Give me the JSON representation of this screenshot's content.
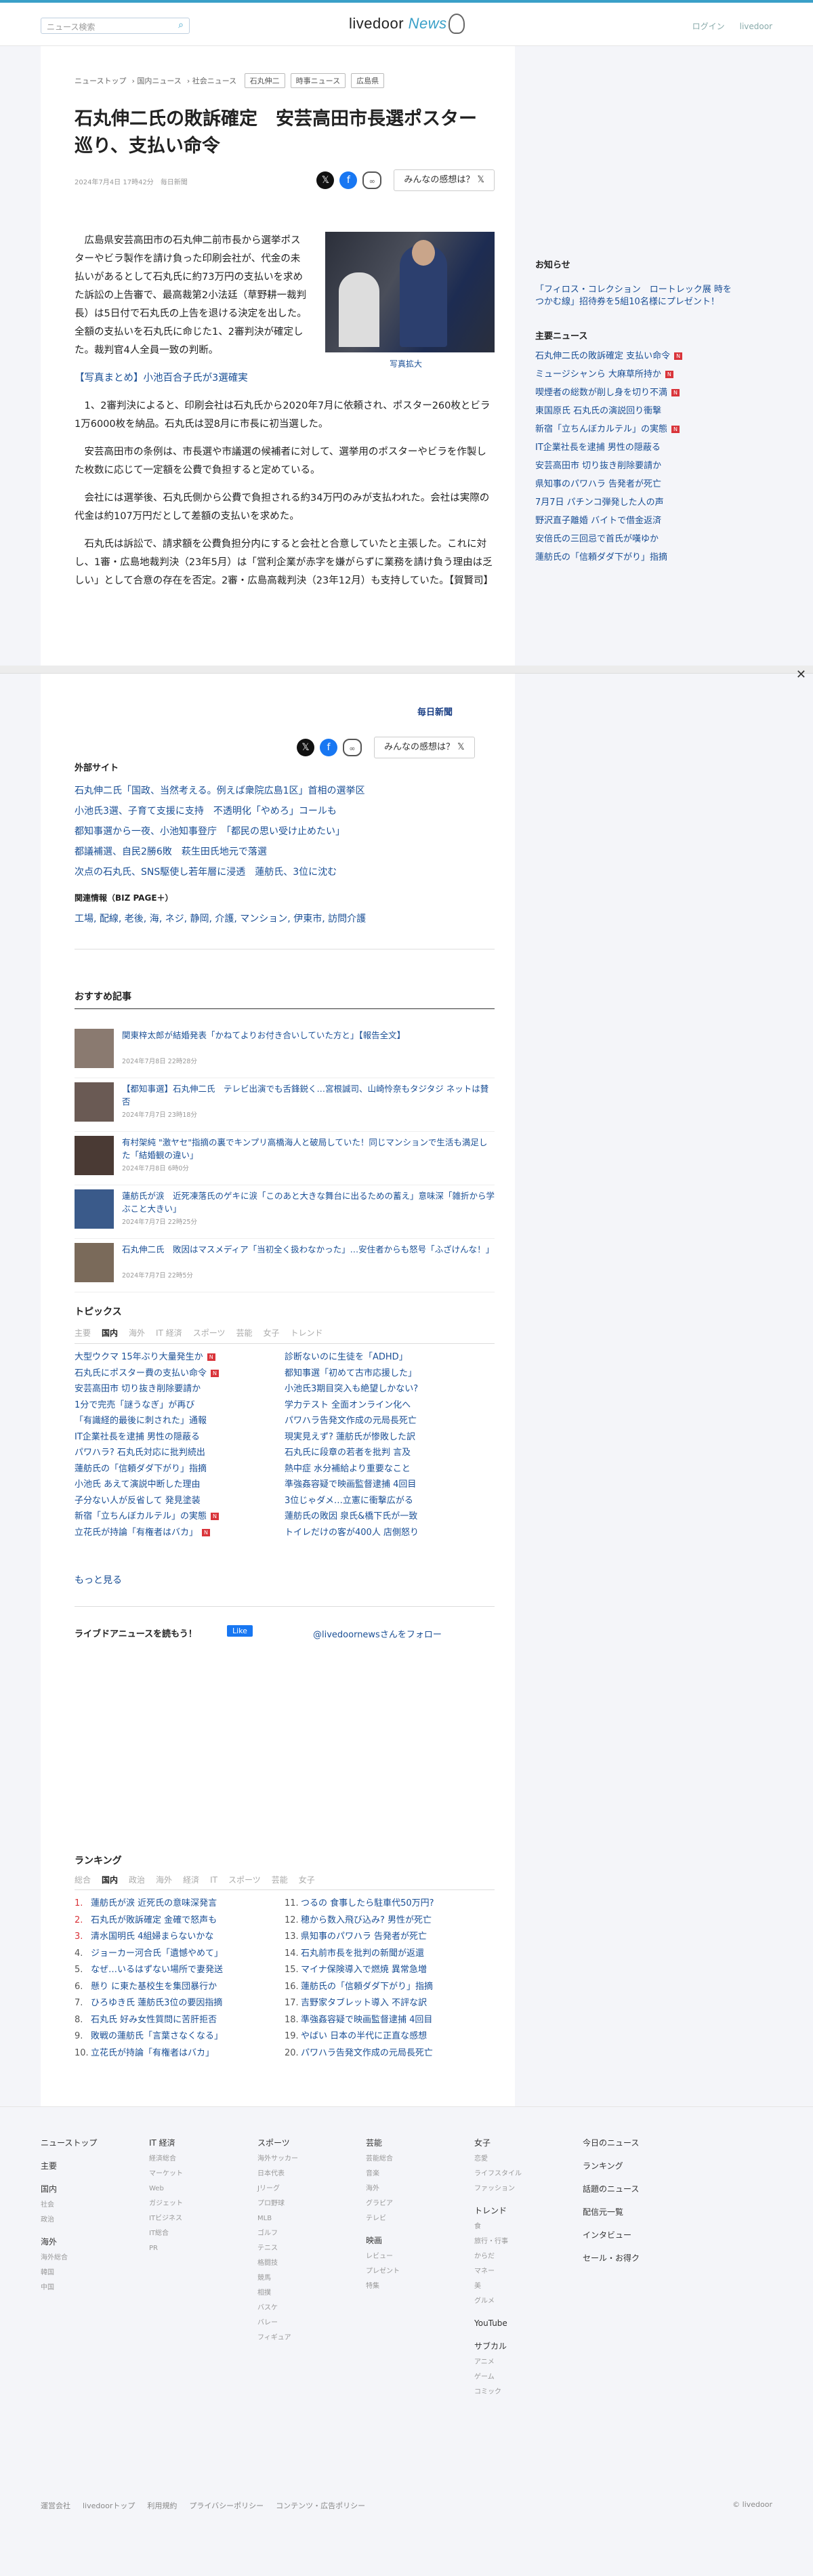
{
  "header": {
    "search_placeholder": "ニュース検索",
    "logo_main": "livedoor ",
    "logo_accent": "News",
    "login": "ログイン",
    "livedoor": "livedoor"
  },
  "breadcrumb": [
    "ニューストップ",
    "国内ニュース",
    "社会ニュース"
  ],
  "tags": [
    "石丸伸二",
    "時事ニュース",
    "広島県"
  ],
  "article": {
    "title": "石丸伸二氏の敗訴確定　安芸高田市長選ポスター巡り、支払い命令",
    "date": "2024年7月4日 17時42分",
    "source": "毎日新聞",
    "caption": "写真拡大",
    "paragraphs": [
      "広島県安芸高田市の石丸伸二前市長から選挙ポスターやビラ製作を請け負った印刷会社が、代金の未払いがあるとして石丸氏に約73万円の支払いを求めた訴訟の上告審で、最高裁第2小法廷（草野耕一裁判長）は5日付で石丸氏の上告を退ける決定を出した。全額の支払いを石丸氏に命じた1、2審判決が確定した。裁判官4人全員一致の判断。",
      "【写真まとめ】小池百合子氏が3選確実",
      "1、2審判決によると、印刷会社は石丸氏から2020年7月に依頼され、ポスター260枚とビラ1万6000枚を納品。石丸氏は翌8月に市長に初当選した。",
      "安芸高田市の条例は、市長選や市議選の候補者に対して、選挙用のポスターやビラを作製した枚数に応じて一定額を公費で負担すると定めている。",
      "会社には選挙後、石丸氏側から公費で負担される約34万円のみが支払われた。会社は実際の代金は約107万円だとして差額の支払いを求めた。",
      "石丸氏は訴訟で、請求額を公費負担分内にすると会社と合意していたと主張した。これに対し、1審・広島地裁判決（23年5月）は「営利企業が赤字を嫌がらずに業務を請け負う理由は乏しい」として合意の存在を否定。2審・広島高裁判決（23年12月）も支持していた。【賀賢司】"
    ]
  },
  "share": {
    "kansou": "みんなの感想は？"
  },
  "mainichi": "毎日新聞",
  "external": {
    "title": "外部サイト",
    "links": [
      "石丸伸二氏「国政、当然考える。例えば衆院広島1区」首相の選挙区",
      "小池氏3選、子育て支援に支持　不透明化「やめろ」コールも",
      "都知事選から一夜、小池知事登庁　「都民の思い受け止めたい」",
      "都議補選、自民2勝6敗　萩生田氏地元で落選",
      "次点の石丸氏、SNS駆使し若年層に浸透　蓮舫氏、3位に沈む"
    ]
  },
  "related": {
    "title": "関連情報（BIZ PAGE＋）",
    "text": "工場, 配線, 老後, 海, ネジ, 静岡, 介護, マンション, 伊東市, 訪問介護"
  },
  "recommend": {
    "title": "おすすめ記事",
    "items": [
      {
        "t": "関東梓太郎が結婚発表「かねてよりお付き合いしていた方と」【報告全文】",
        "d": "2024年7月8日 22時28分"
      },
      {
        "t": "【都知事選】石丸伸二氏　テレビ出演でも舌鋒鋭く…宮根誠司、山崎怜奈もタジタジ ネットは賛否",
        "d": "2024年7月7日 23時18分"
      },
      {
        "t": "有村架純 \"激ヤセ\"指摘の裏でキンプリ高橋海人と破局していた！同じマンションで生活も満足した「結婚観の違い」",
        "d": "2024年7月8日 6時0分"
      },
      {
        "t": "蓮舫氏が涙　近死凍落氏のゲキに涙「このあと大きな舞台に出るための蓄え」意味深「雑折から学ぶこと大きい」",
        "d": "2024年7月7日 22時25分"
      },
      {
        "t": "石丸伸二氏　敗因はマスメディア「当初全く扱わなかった」…安住者からも怒号「ふざけんな！」",
        "d": "2024年7月7日 22時5分"
      }
    ]
  },
  "topics": {
    "title": "トピックス",
    "tabs": [
      "主要",
      "国内",
      "海外",
      "IT 経済",
      "スポーツ",
      "芸能",
      "女子",
      "トレンド"
    ],
    "left": [
      "大型ウクマ 15年ぶり大量発生か",
      "石丸氏にポスター費の支払い命令",
      "安芸高田市 切り抜き削除要請か",
      "1分で完売「謎うなぎ」が再び",
      "「有識経的最後に刺された」通報",
      "IT企業社長を逮捕 男性の隠蔽る",
      "パワハラ? 石丸氏対応に批判続出",
      "蓮舫氏の「信頼ダダ下がり」指摘",
      "小池氏 あえて演説中断した理由",
      "子分ない人が反省して 発見塗装",
      "新宿「立ちんぼカルテル」の実態",
      "立花氏が持論「有権者はバカ」"
    ],
    "right": [
      "診断ないのに生徒を「ADHD」",
      "都知事選「初めて古市応援した」",
      "小池氏3期目突入も絶望しかない?",
      "学力テスト 全面オンライン化へ",
      "パワハラ告発文作成の元局長死亡",
      "現実見えず? 蓮舫氏が惨敗した訳",
      "石丸氏に段章の若者を批判 言及",
      "熱中症 水分補給より重要なこと",
      "準強姦容疑で映画監督逮捕 4回目",
      "3位じゃダメ…立憲に衝撃広がる",
      "蓮舫氏の敗因 泉氏&橋下氏が一致",
      "トイレだけの客が400人 店側怒り"
    ],
    "new_left": [
      0,
      1,
      10,
      11
    ],
    "more": "もっと見る"
  },
  "live": {
    "text": "ライブドアニュースを読もう！",
    "like": "Like",
    "follow": "@livedoornewsさんをフォロー"
  },
  "ranking": {
    "title": "ランキング",
    "tabs": [
      "総合",
      "国内",
      "政治",
      "海外",
      "経済",
      "IT",
      "スポーツ",
      "芸能",
      "女子"
    ],
    "left": [
      "蓮舫氏が涙 近死氏の意味深発言",
      "石丸氏が敗訴確定 金確で怒声も",
      "清水国明氏 4組婦まらないかな",
      "ジョーカー河合氏「遺憾やめて」",
      "なぜ…いるはずない場所で妻発送",
      "懸り に東た基校生を集団暴行か",
      "ひろゆき氏 蓮舫氏3位の要因指摘",
      "石丸氏 好み女性質問に苦肝拒否",
      "敗戦の蓮舫氏「言葉さなくなる」",
      "立花氏が持論「有権者はバカ」"
    ],
    "right": [
      "つるの 食事したら駐車代50万円?",
      "穂から数入飛び込み? 男性が死亡",
      "県知事のパワハラ 告発者が死亡",
      "石丸前市長を批判の新聞が返還",
      "マイナ保険導入で燃焼 異常急増",
      "蓮舫氏の「信頼ダダ下がり」指摘",
      "吉野家タブレット導入 不評な訳",
      "準強姦容疑で映画監督逮捕 4回目",
      "やばい 日本の半代に正直な感想",
      "パワハラ告発文作成の元局長死亡"
    ]
  },
  "sidebar": {
    "notice_title": "お知らせ",
    "notice": "「フィロス・コレクション　ロートレック展 時をつかむ線」招待券を5組10名様にプレゼント！",
    "news_title": "主要ニュース",
    "news": [
      "石丸伸二氏の敗訴確定 支払い命令",
      "ミュージシャンら 大麻草所持か",
      "喫煙者の総数が削し身を切り不満",
      "東国原氏 石丸氏の演説回り衝撃",
      "新宿「立ちんぼカルテル」の実態",
      "IT企業社長を逮捕 男性の隠蔽る",
      "安芸高田市 切り抜き削除要請か",
      "県知事のパワハラ 告発者が死亡",
      "7月7日 パチンコ弾発した人の声",
      "野沢直子離婚 バイトで借金返済",
      "安倍氏の三回忌で首氏が嘆ゆか",
      "蓮舫氏の「信頼ダダ下がり」指摘"
    ],
    "news_new": [
      0,
      1,
      2,
      4
    ]
  },
  "footer": {
    "cols": [
      {
        "h": "ニューストップ",
        "items": [],
        "subs": [
          {
            "h": "主要",
            "items": []
          },
          {
            "h": "国内",
            "items": [
              "社会",
              "政治"
            ]
          },
          {
            "h": "海外",
            "items": [
              "海外総合",
              "韓国",
              "中国"
            ]
          }
        ]
      },
      {
        "h": "IT 経済",
        "items": [
          "経済総合",
          "マーケット",
          "Web",
          "ガジェット",
          "ITビジネス",
          "IT総合",
          "PR"
        ],
        "subs": []
      },
      {
        "h": "スポーツ",
        "items": [
          "海外サッカー",
          "日本代表",
          "Jリーグ",
          "プロ野球",
          "MLB",
          "ゴルフ",
          "テニス",
          "格闘技",
          "競馬",
          "相撲",
          "バスケ",
          "バレー",
          "フィギュア"
        ],
        "subs": []
      },
      {
        "h": "芸能",
        "items": [
          "芸能総合",
          "音楽",
          "海外",
          "グラビア",
          "テレビ"
        ],
        "subs": [
          {
            "h": "映画",
            "items": [
              "レビュー",
              "プレゼント",
              "特集"
            ]
          }
        ]
      },
      {
        "h": "女子",
        "items": [
          "恋愛",
          "ライフスタイル",
          "ファッション"
        ],
        "subs": [
          {
            "h": "トレンド",
            "items": [
              "食",
              "旅行・行事",
              "からだ",
              "マネー",
              "美",
              "グルメ"
            ]
          },
          {
            "h": "YouTube",
            "items": []
          },
          {
            "h": "サブカル",
            "items": [
              "アニメ",
              "ゲーム",
              "コミック"
            ]
          }
        ]
      },
      {
        "h": "今日のニュース",
        "items": [],
        "subs": [
          {
            "h": "ランキング",
            "items": []
          },
          {
            "h": "話題のニュース",
            "items": []
          },
          {
            "h": "配信元一覧",
            "items": []
          },
          {
            "h": "インタビュー",
            "items": []
          },
          {
            "h": "セール・お得ク",
            "items": []
          }
        ]
      }
    ],
    "bottom": [
      "運営会社",
      "livedoorトップ",
      "利用規約",
      "プライバシーポリシー",
      "コンテンツ・広告ポリシー"
    ],
    "copy": "© livedoor"
  }
}
